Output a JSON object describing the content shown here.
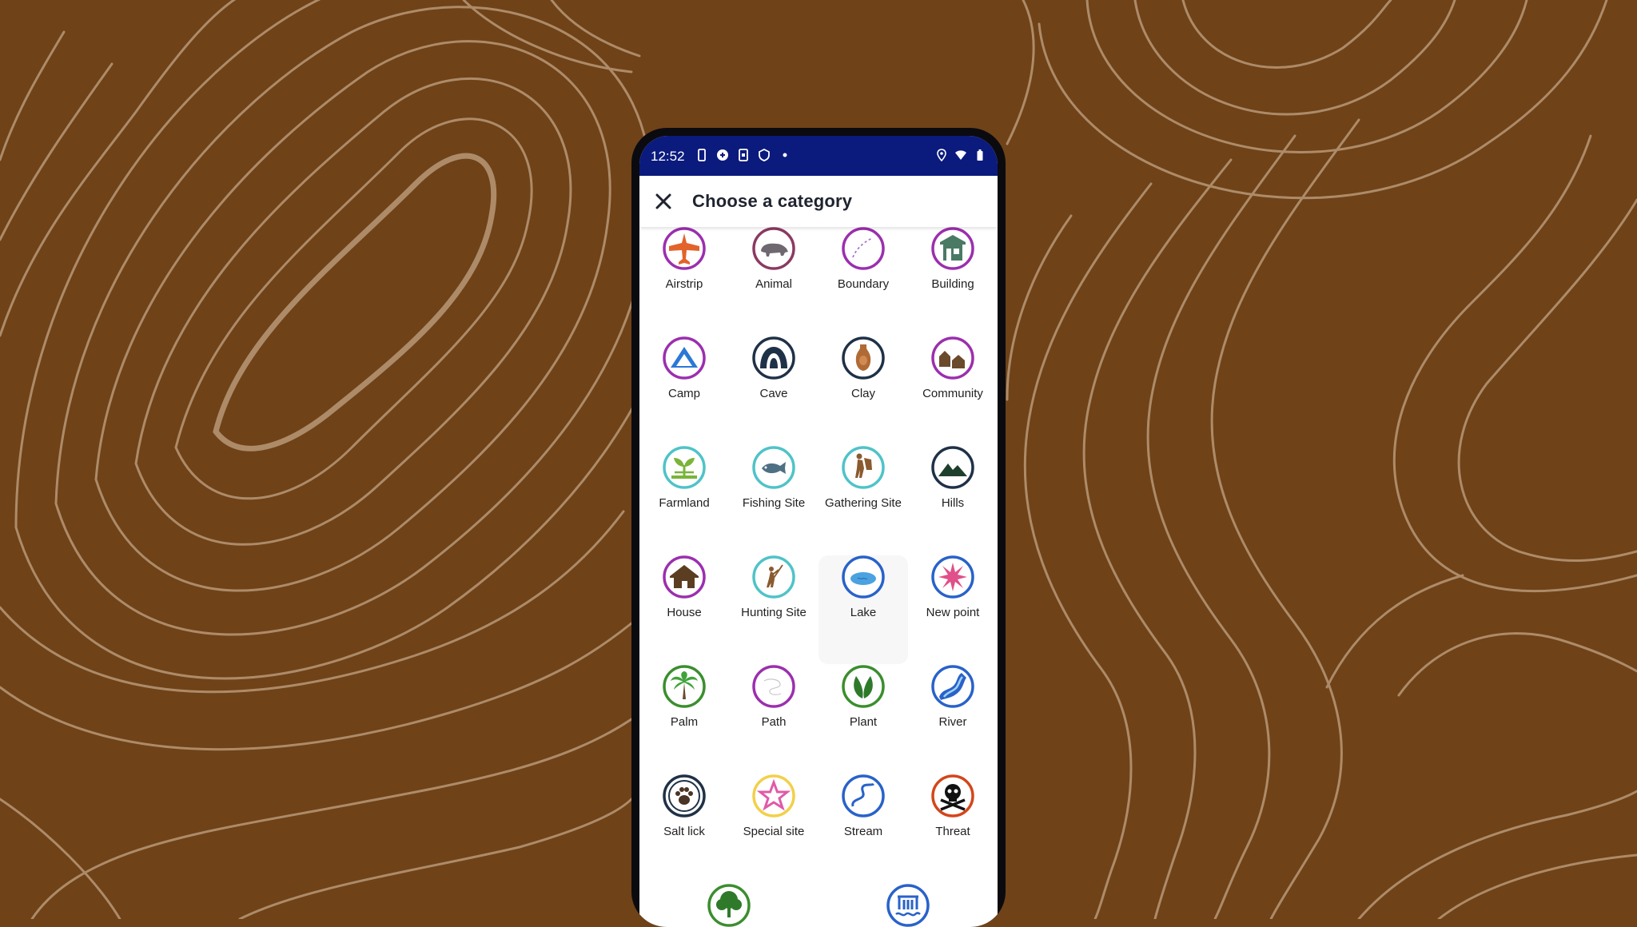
{
  "status_bar": {
    "time": "12:52"
  },
  "header": {
    "title": "Choose a category"
  },
  "categories": [
    {
      "label": "Airstrip",
      "icon": "airstrip-icon"
    },
    {
      "label": "Animal",
      "icon": "animal-icon"
    },
    {
      "label": "Boundary",
      "icon": "boundary-icon"
    },
    {
      "label": "Building",
      "icon": "building-icon"
    },
    {
      "label": "Camp",
      "icon": "camp-icon"
    },
    {
      "label": "Cave",
      "icon": "cave-icon"
    },
    {
      "label": "Clay",
      "icon": "clay-icon"
    },
    {
      "label": "Community",
      "icon": "community-icon"
    },
    {
      "label": "Farmland",
      "icon": "farmland-icon"
    },
    {
      "label": "Fishing Site",
      "icon": "fishing-site-icon"
    },
    {
      "label": "Gathering Site",
      "icon": "gathering-site-icon"
    },
    {
      "label": "Hills",
      "icon": "hills-icon"
    },
    {
      "label": "House",
      "icon": "house-icon"
    },
    {
      "label": "Hunting Site",
      "icon": "hunting-site-icon"
    },
    {
      "label": "Lake",
      "icon": "lake-icon"
    },
    {
      "label": "New point",
      "icon": "new-point-icon"
    },
    {
      "label": "Palm",
      "icon": "palm-icon"
    },
    {
      "label": "Path",
      "icon": "path-icon"
    },
    {
      "label": "Plant",
      "icon": "plant-icon"
    },
    {
      "label": "River",
      "icon": "river-icon"
    },
    {
      "label": "Salt lick",
      "icon": "salt-lick-icon"
    },
    {
      "label": "Special site",
      "icon": "special-site-icon"
    },
    {
      "label": "Stream",
      "icon": "stream-icon"
    },
    {
      "label": "Threat",
      "icon": "threat-icon"
    }
  ],
  "partial_row": [
    {
      "icon": "tree-icon"
    },
    {
      "icon": "water-icon"
    }
  ],
  "colors": {
    "background": "#6f4218",
    "contour": "#b89878",
    "status_bar": "#0b1a7d",
    "purple_ring": "#9b2fae",
    "navy_ring": "#1f3147",
    "teal_ring": "#4fc3c8",
    "blue_ring": "#2962c9",
    "green_ring": "#3b8e2e"
  }
}
